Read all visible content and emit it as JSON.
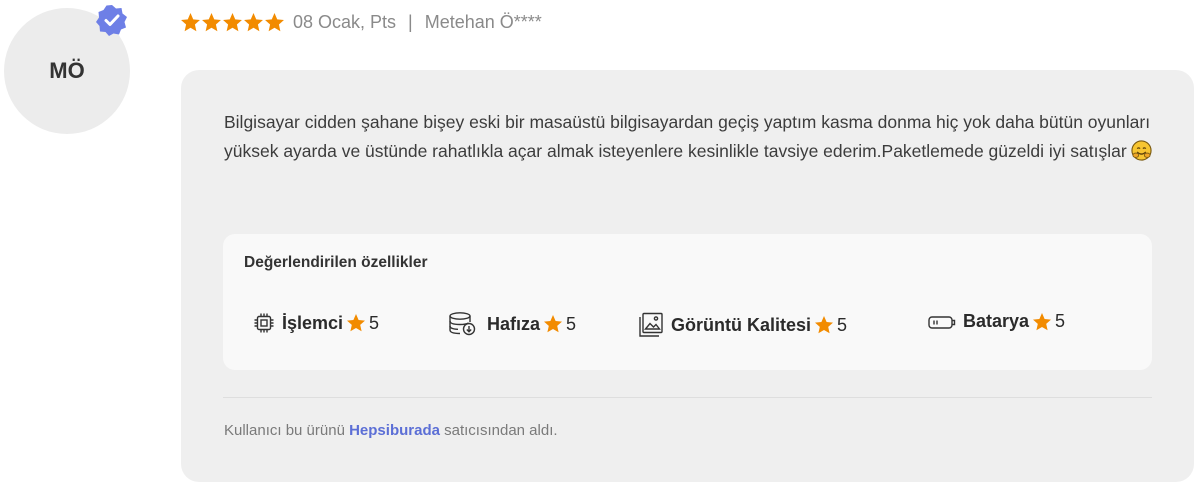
{
  "avatar": {
    "initials": "MÖ",
    "verified_color": "#6e7fe6"
  },
  "header": {
    "rating": 5,
    "star_color": "#f28b00",
    "date": "08 Ocak, Pts",
    "separator": "|",
    "username": "Metehan Ö****"
  },
  "review": {
    "text": "Bilgisayar cidden şahane bişey eski bir masaüstü bilgisayardan geçiş yaptım kasma donma hiç yok daha bütün oyunları yüksek ayarda ve üstünde rahatlıkla açar almak isteyenlere kesinlikle tavsiye ederim.Paketlemede güzeldi iyi satışlar",
    "emoji": "smiling-hug-emoji"
  },
  "features": {
    "title": "Değerlendirilen özellikler",
    "items": [
      {
        "icon": "cpu-icon",
        "label": "İşlemci",
        "score": "5"
      },
      {
        "icon": "storage-icon",
        "label": "Hafıza",
        "score": "5"
      },
      {
        "icon": "image-icon",
        "label": "Görüntü Kalitesi",
        "score": "5"
      },
      {
        "icon": "battery-icon",
        "label": "Batarya",
        "score": "5"
      }
    ]
  },
  "footer": {
    "prefix": "Kullanıcı bu ürünü",
    "seller": "Hepsiburada",
    "suffix": "satıcısından aldı.",
    "seller_color": "#5c6fd6"
  }
}
